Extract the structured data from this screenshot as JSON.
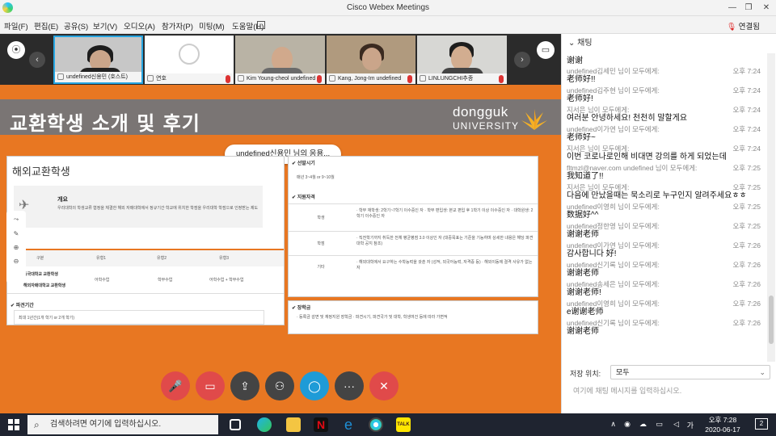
{
  "window": {
    "title": "Cisco Webex Meetings",
    "minimize": "—",
    "restore": "❐",
    "close": "✕"
  },
  "menu": {
    "items": [
      "파일(F)",
      "편집(E)",
      "공유(S)",
      "보기(V)",
      "오디오(A)",
      "참가자(P)",
      "미팅(M)",
      "도움말(H)"
    ],
    "user": "연결됨"
  },
  "filmstrip": {
    "participants": [
      {
        "name": "undefined신용민 (호스트)"
      },
      {
        "name": "연호"
      },
      {
        "name": "Kim Young-cheol undefined"
      },
      {
        "name": "Kang, Jong-Im undefined"
      },
      {
        "name": "LINLUNGCHI추종"
      }
    ]
  },
  "slide": {
    "title": "교환학생 소개 및 후기",
    "brand_line1": "dongguk",
    "brand_line2": "UNIVERSITY",
    "speaker_toast": "undefined신용민 님의 응용...",
    "left_heading": "해외교환학생",
    "left_overview": "개요",
    "left_overview_text": "우리대학의 학생교류 협정을 체결한 해외 자매대학에서 정규기간 학교에 위치한 학점을 우리대학 학점으로 인정받는 제도",
    "table_headers": [
      "구분",
      "유형1",
      "유형2",
      "유형3"
    ],
    "table_rows": [
      {
        "label": "동국대학교 교환학생",
        "c1": "어학수업",
        "c2": "학부수업",
        "c3": "어학수업 + 학부수업"
      },
      {
        "label": "해외자매대학교 교환학생"
      }
    ],
    "period_title": "파견기간",
    "period_text": "최대 1년간(1개 학기 or 2개 학기)",
    "right_s1": "선발시기",
    "right_s1_text": "매년 3~4월 or 9~10월",
    "right_s2": "지원자격",
    "right_rows": [
      {
        "label": "학생",
        "text": "· 학부 재학생: 2학기~7학기 이수중인 자 · 학부 편입생: 본교 편입 후 1학기 이상 이수중인 자 · 대학원생: 2학기 이수중인 자"
      },
      {
        "label": "학점",
        "text": "· 직전학기까지 취득한 전체 평균평점 3.0 이상인 자 (대중목표는 기준을 기능하며 상세한 내용은 해당 파견대학 공지 참조)"
      },
      {
        "label": "기타",
        "text": "· 해외대학에서 요구하는 수학능력을 갖춘 자 (성적, 외국어능력, 자격증 등) · 해외이동에 결격 사유가 없는 자"
      }
    ],
    "right_s3": "장학금",
    "right_s3_text": "· 등록금 감면 및 재정지원 장학금 · 파견시기, 파견국가 및 대학, 학생여건 등에 따라 가변적"
  },
  "toolbar": {
    "buttons": [
      {
        "name": "mute-button",
        "icon": "🎤",
        "color": "#e04a4a"
      },
      {
        "name": "video-button",
        "icon": "📹",
        "color": "#e04a4a"
      },
      {
        "name": "share-button",
        "icon": "⇪",
        "color": "#444444"
      },
      {
        "name": "participants-button",
        "icon": "👤",
        "color": "#444444"
      },
      {
        "name": "chat-button",
        "icon": "💬",
        "color": "#1e9bd7"
      },
      {
        "name": "more-button",
        "icon": "···",
        "color": "#444444"
      },
      {
        "name": "leave-button",
        "icon": "✕",
        "color": "#e04a4a"
      }
    ]
  },
  "chat": {
    "header": "채팅",
    "messages": [
      {
        "meta": "",
        "time": "",
        "text": "谢谢"
      },
      {
        "meta": "undefined김세민 님이 모두에게:",
        "time": "오후 7:24",
        "text": "老师好!!"
      },
      {
        "meta": "undefined김주현 님이 모두에게:",
        "time": "오후 7:24",
        "text": "老师好!"
      },
      {
        "meta": "지서은 님이 모두에게:",
        "time": "오후 7:24",
        "text": "여러분 안녕하세요! 천천히 말할게요"
      },
      {
        "meta": "undefined이가연 님이 모두에게:",
        "time": "오후 7:24",
        "text": "老师好~"
      },
      {
        "meta": "지서은 님이 모두에게:",
        "time": "오후 7:24",
        "text": "이번 코로나로인해 비대면 강의를 하게 되었는데"
      },
      {
        "meta": "fltmzl@naver.com undefined 님이 모두에게:",
        "time": "오후 7:25",
        "text": "我知道了!!"
      },
      {
        "meta": "지서은 님이 모두에게:",
        "time": "오후 7:25",
        "text": "다음에 만났을때는 묵소리로 누구인지 알려주세요ㅎㅎ"
      },
      {
        "meta": "undefined이영희 님이 모두에게:",
        "time": "오후 7:25",
        "text": "数据好^^"
      },
      {
        "meta": "undefined정한영 님이 모두에게:",
        "time": "오후 7:25",
        "text": "谢谢老师"
      },
      {
        "meta": "undefined이가연 님이 모두에게:",
        "time": "오후 7:26",
        "text": "감사합니다 好!"
      },
      {
        "meta": "undefined신기록 님이 모두에게:",
        "time": "오후 7:26",
        "text": "谢谢老师"
      },
      {
        "meta": "undefined송세은 님이 모두에게:",
        "time": "오후 7:26",
        "text": "谢谢老师!"
      },
      {
        "meta": "undefined이영희 님이 모두에게:",
        "time": "오후 7:26",
        "text": "e谢谢老师"
      },
      {
        "meta": "undefined신기록 님이 모두에게:",
        "time": "오후 7:26",
        "text": "谢谢老师"
      }
    ],
    "to_label": "저장 위치:",
    "to_value": "모두",
    "input_placeholder": "여기에 채팅 메시지를 입력하십시오."
  },
  "taskbar": {
    "search_placeholder": "검색하려면 여기에 입력하십시오.",
    "time": "오후 7:28",
    "date": "2020-06-17",
    "lang": "가",
    "notifications": "2"
  }
}
